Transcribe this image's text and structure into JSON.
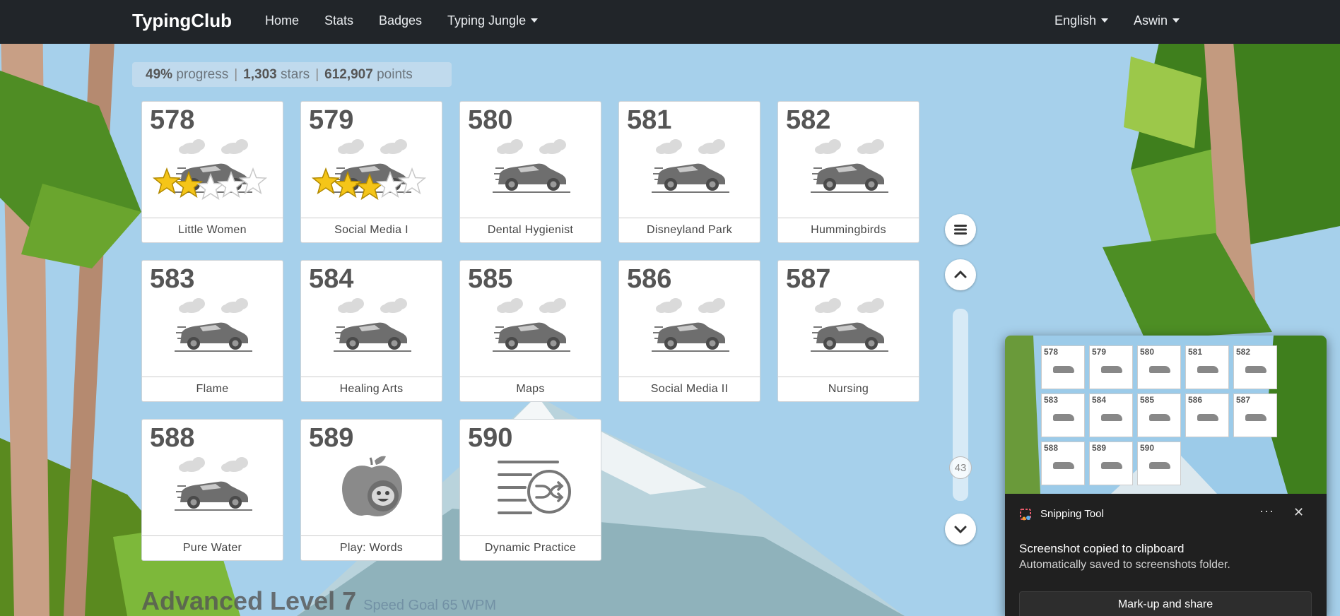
{
  "nav": {
    "brand": "TypingClub",
    "home": "Home",
    "stats": "Stats",
    "badges": "Badges",
    "jungle": "Typing Jungle",
    "language": "English",
    "user": "Aswin"
  },
  "stats": {
    "progress_value": "49%",
    "progress_label": "progress",
    "stars_value": "1,303",
    "stars_label": "stars",
    "points_value": "612,907",
    "points_label": "points",
    "separator": "|"
  },
  "lessons": [
    {
      "num": "578",
      "name": "Little Women",
      "stars": 2,
      "icon": "race-car-icon"
    },
    {
      "num": "579",
      "name": "Social Media I",
      "stars": 3,
      "icon": "race-car-icon"
    },
    {
      "num": "580",
      "name": "Dental Hygienist",
      "stars": 0,
      "icon": "race-car-icon"
    },
    {
      "num": "581",
      "name": "Disneyland Park",
      "stars": 0,
      "icon": "race-car-icon"
    },
    {
      "num": "582",
      "name": "Hummingbirds",
      "stars": 0,
      "icon": "race-car-icon"
    },
    {
      "num": "583",
      "name": "Flame",
      "stars": 0,
      "icon": "race-car-icon"
    },
    {
      "num": "584",
      "name": "Healing Arts",
      "stars": 0,
      "icon": "race-car-icon"
    },
    {
      "num": "585",
      "name": "Maps",
      "stars": 0,
      "icon": "race-car-icon"
    },
    {
      "num": "586",
      "name": "Social Media II",
      "stars": 0,
      "icon": "race-car-icon"
    },
    {
      "num": "587",
      "name": "Nursing",
      "stars": 0,
      "icon": "race-car-icon"
    },
    {
      "num": "588",
      "name": "Pure Water",
      "stars": 0,
      "icon": "race-car-icon"
    },
    {
      "num": "589",
      "name": "Play: Words",
      "stars": 0,
      "icon": "apple-game-icon"
    },
    {
      "num": "590",
      "name": "Dynamic Practice",
      "stars": 0,
      "icon": "shuffle-practice-icon"
    }
  ],
  "scroll": {
    "indicator": "43"
  },
  "level": {
    "title": "Advanced Level 7",
    "goal": "Speed Goal 65 WPM"
  },
  "snip": {
    "title": "Snipping Tool",
    "more": "···",
    "message": "Screenshot copied to clipboard",
    "sub": "Automatically saved to screenshots folder.",
    "action": "Mark-up and share"
  },
  "colors": {
    "navbar": "#212529",
    "star": "#f5c518",
    "sky": "#a9d2ec"
  }
}
